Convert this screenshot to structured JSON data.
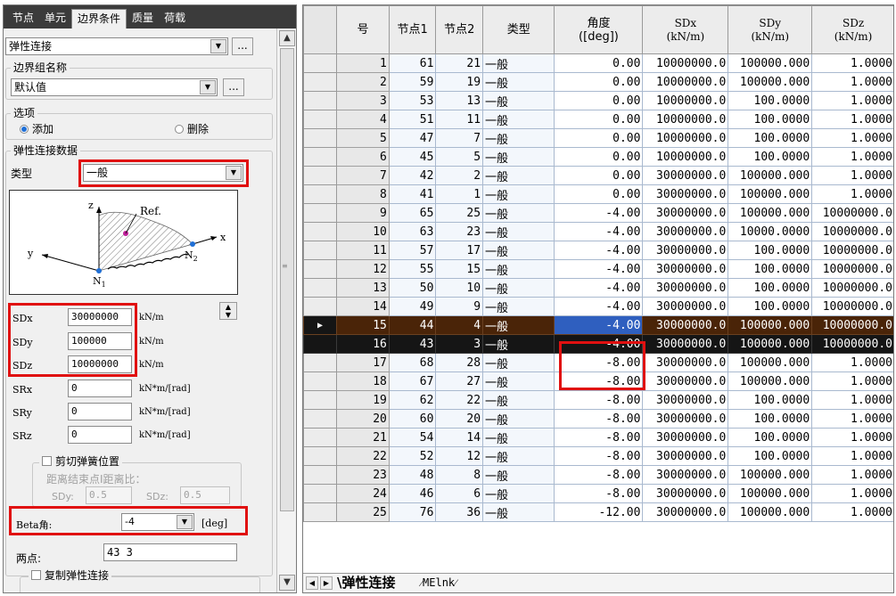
{
  "left": {
    "tabs": [
      "节点",
      "单元",
      "边界条件",
      "质量",
      "荷载"
    ],
    "active_tab": 2,
    "function_select": "弹性连接",
    "ellipsis": "...",
    "boundary_group": {
      "title": "边界组名称",
      "value": "默认值"
    },
    "options": {
      "title": "选项",
      "add": "添加",
      "delete": "删除"
    },
    "link_data": {
      "title": "弹性连接数据",
      "type_label": "类型",
      "type_value": "一般",
      "diagram": {
        "z": "z",
        "y": "y",
        "x": "x",
        "ref": "Ref.",
        "n1": "N",
        "n1_sub": "1",
        "n2": "N",
        "n2_sub": "2"
      },
      "stiffness": [
        {
          "label": "SDx",
          "value": "30000000",
          "unit": "kN/m"
        },
        {
          "label": "SDy",
          "value": "100000",
          "unit": "kN/m"
        },
        {
          "label": "SDz",
          "value": "10000000",
          "unit": "kN/m"
        },
        {
          "label": "SRx",
          "value": "0",
          "unit": "kN*m/[rad]"
        },
        {
          "label": "SRy",
          "value": "0",
          "unit": "kN*m/[rad]"
        },
        {
          "label": "SRz",
          "value": "0",
          "unit": "kN*m/[rad]"
        }
      ],
      "shear": {
        "label": "剪切弹簧位置",
        "ratio_label": "距离结束点I距离比：",
        "sdy_label": "SDy:",
        "sdy_value": "0.5",
        "sdz_label": "SDz:",
        "sdz_value": "0.5"
      }
    },
    "beta": {
      "label": "Beta角:",
      "value": "-4",
      "unit": "[deg]"
    },
    "two_points": {
      "label": "两点:",
      "value": "43 3"
    },
    "copy_link": "复制弹性连接"
  },
  "grid": {
    "columns": [
      "号",
      "节点1",
      "节点2",
      "类型",
      "角度\n([deg])",
      "SDx\n(kN/m)",
      "SDy\n(kN/m)",
      "SDz\n(kN/m)"
    ],
    "rows": [
      [
        "1",
        "61",
        "21",
        "一般",
        "0.00",
        "10000000.0",
        "100000.000",
        "1.0000"
      ],
      [
        "2",
        "59",
        "19",
        "一般",
        "0.00",
        "10000000.0",
        "100000.000",
        "1.0000"
      ],
      [
        "3",
        "53",
        "13",
        "一般",
        "0.00",
        "10000000.0",
        "100.0000",
        "1.0000"
      ],
      [
        "4",
        "51",
        "11",
        "一般",
        "0.00",
        "10000000.0",
        "100.0000",
        "1.0000"
      ],
      [
        "5",
        "47",
        "7",
        "一般",
        "0.00",
        "10000000.0",
        "100.0000",
        "1.0000"
      ],
      [
        "6",
        "45",
        "5",
        "一般",
        "0.00",
        "10000000.0",
        "100.0000",
        "1.0000"
      ],
      [
        "7",
        "42",
        "2",
        "一般",
        "0.00",
        "30000000.0",
        "100000.000",
        "1.0000"
      ],
      [
        "8",
        "41",
        "1",
        "一般",
        "0.00",
        "30000000.0",
        "100000.000",
        "1.0000"
      ],
      [
        "9",
        "65",
        "25",
        "一般",
        "-4.00",
        "30000000.0",
        "100000.000",
        "10000000.0"
      ],
      [
        "10",
        "63",
        "23",
        "一般",
        "-4.00",
        "30000000.0",
        "10000.0000",
        "10000000.0"
      ],
      [
        "11",
        "57",
        "17",
        "一般",
        "-4.00",
        "30000000.0",
        "100.0000",
        "10000000.0"
      ],
      [
        "12",
        "55",
        "15",
        "一般",
        "-4.00",
        "30000000.0",
        "100.0000",
        "10000000.0"
      ],
      [
        "13",
        "50",
        "10",
        "一般",
        "-4.00",
        "30000000.0",
        "100.0000",
        "10000000.0"
      ],
      [
        "14",
        "49",
        "9",
        "一般",
        "-4.00",
        "30000000.0",
        "100.0000",
        "10000000.0"
      ],
      [
        "15",
        "44",
        "4",
        "一般",
        "-4.00",
        "30000000.0",
        "100000.000",
        "10000000.0"
      ],
      [
        "16",
        "43",
        "3",
        "一般",
        "-4.00",
        "30000000.0",
        "100000.000",
        "10000000.0"
      ],
      [
        "17",
        "68",
        "28",
        "一般",
        "-8.00",
        "30000000.0",
        "100000.000",
        "1.0000"
      ],
      [
        "18",
        "67",
        "27",
        "一般",
        "-8.00",
        "30000000.0",
        "100000.000",
        "1.0000"
      ],
      [
        "19",
        "62",
        "22",
        "一般",
        "-8.00",
        "30000000.0",
        "100.0000",
        "1.0000"
      ],
      [
        "20",
        "60",
        "20",
        "一般",
        "-8.00",
        "30000000.0",
        "100.0000",
        "1.0000"
      ],
      [
        "21",
        "54",
        "14",
        "一般",
        "-8.00",
        "30000000.0",
        "100.0000",
        "1.0000"
      ],
      [
        "22",
        "52",
        "12",
        "一般",
        "-8.00",
        "30000000.0",
        "100.0000",
        "1.0000"
      ],
      [
        "23",
        "48",
        "8",
        "一般",
        "-8.00",
        "30000000.0",
        "100000.000",
        "1.0000"
      ],
      [
        "24",
        "46",
        "6",
        "一般",
        "-8.00",
        "30000000.0",
        "100000.000",
        "1.0000"
      ],
      [
        "25",
        "76",
        "36",
        "一般",
        "-12.00",
        "30000000.0",
        "100000.000",
        "1.0000"
      ]
    ],
    "highlight_rows": [
      "15",
      "16"
    ],
    "sheet_tabs": [
      "弹性连接",
      "MElnk"
    ],
    "colors": {
      "highlight_dark": "#4a2408",
      "highlight_black": "#151515",
      "highlight_blue": "#2f5fbf",
      "annotation_red": "#e01010"
    }
  }
}
